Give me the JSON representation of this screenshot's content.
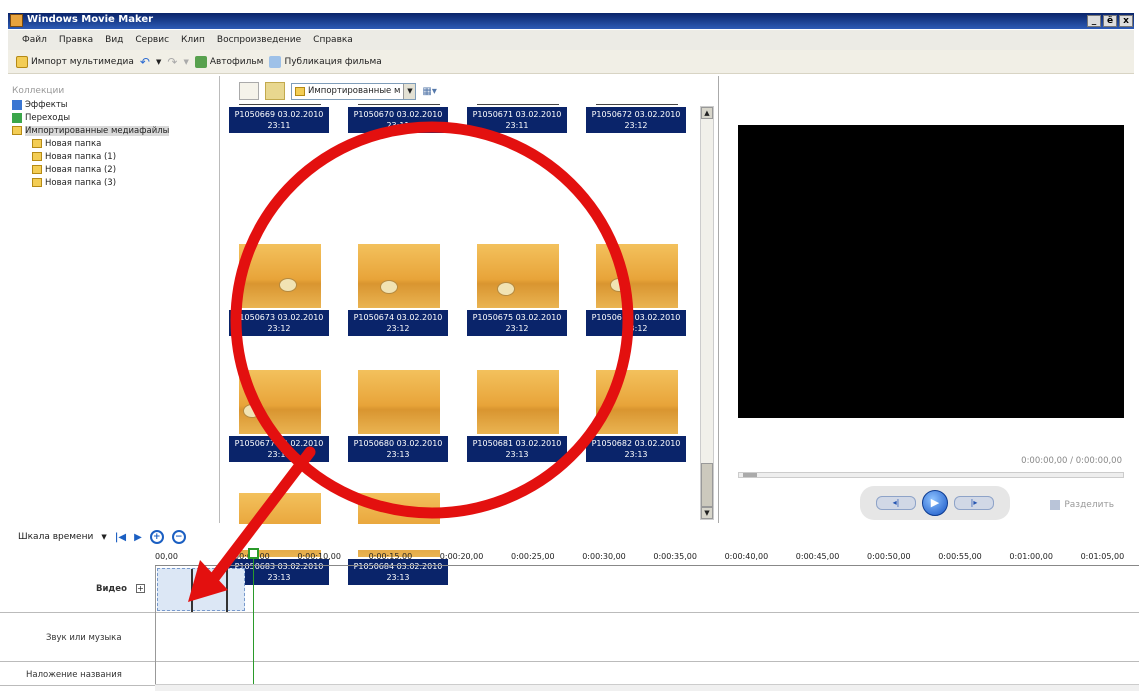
{
  "window": {
    "title": "Windows Movie Maker",
    "buttons": [
      "_",
      "ё",
      "x"
    ]
  },
  "menu": [
    "Файл",
    "Правка",
    "Вид",
    "Сервис",
    "Клип",
    "Воспроизведение",
    "Справка"
  ],
  "toolbar": {
    "import_label": "Импорт мультимедиа",
    "automovie_label": "Автофильм",
    "publish_label": "Публикация фильма"
  },
  "collections": {
    "header": "Коллекции",
    "items": [
      {
        "label": "Эффекты",
        "icon": "effects-icon"
      },
      {
        "label": "Переходы",
        "icon": "transitions-icon"
      },
      {
        "label": "Импортированные медиафайлы",
        "icon": "folder-icon",
        "selected": true
      }
    ],
    "subfolders": [
      "Новая папка",
      "Новая папка (1)",
      "Новая папка (2)",
      "Новая папка (3)"
    ]
  },
  "content": {
    "dropdown_value": "Импортированные м",
    "clips": [
      {
        "name": "P1050669 03.02.2010",
        "time": "23:11"
      },
      {
        "name": "P1050670 03.02.2010",
        "time": "23:11"
      },
      {
        "name": "P1050671 03.02.2010",
        "time": "23:11"
      },
      {
        "name": "P1050672 03.02.2010",
        "time": "23:12"
      },
      {
        "name": "P1050673 03.02.2010",
        "time": "23:12"
      },
      {
        "name": "P1050674 03.02.2010",
        "time": "23:12"
      },
      {
        "name": "P1050675 03.02.2010",
        "time": "23:12"
      },
      {
        "name": "P1050676 03.02.2010",
        "time": "23:12"
      },
      {
        "name": "P1050677 03.02.2010",
        "time": "23:12"
      },
      {
        "name": "P1050680 03.02.2010",
        "time": "23:13"
      },
      {
        "name": "P1050681 03.02.2010",
        "time": "23:13"
      },
      {
        "name": "P1050682 03.02.2010",
        "time": "23:13"
      },
      {
        "name": "P1050683 03.02.2010",
        "time": "23:13"
      },
      {
        "name": "P1050684 03.02.2010",
        "time": "23:13"
      }
    ]
  },
  "preview": {
    "time": "0:00:00,00 / 0:00:00,00",
    "split_label": "Разделить"
  },
  "timeline": {
    "mode_label": "Шкала времени",
    "ruler": [
      "00,00",
      "0:00:05,00",
      "0:00:10,00",
      "0:00:15,00",
      "0:00:20,00",
      "0:00:25,00",
      "0:00:30,00",
      "0:00:35,00",
      "0:00:40,00",
      "0:00:45,00",
      "0:00:50,00",
      "0:00:55,00",
      "0:01:00,00",
      "0:01:05,00",
      "0:0"
    ],
    "tracks": {
      "video": "Видео",
      "audio": "Звук или музыка",
      "title_overlay": "Наложение названия"
    }
  },
  "colors": {
    "titlebar": "#0a246a",
    "selection": "#0a246a",
    "annotation": "#e3100f",
    "playhead": "#2a9a2a"
  }
}
